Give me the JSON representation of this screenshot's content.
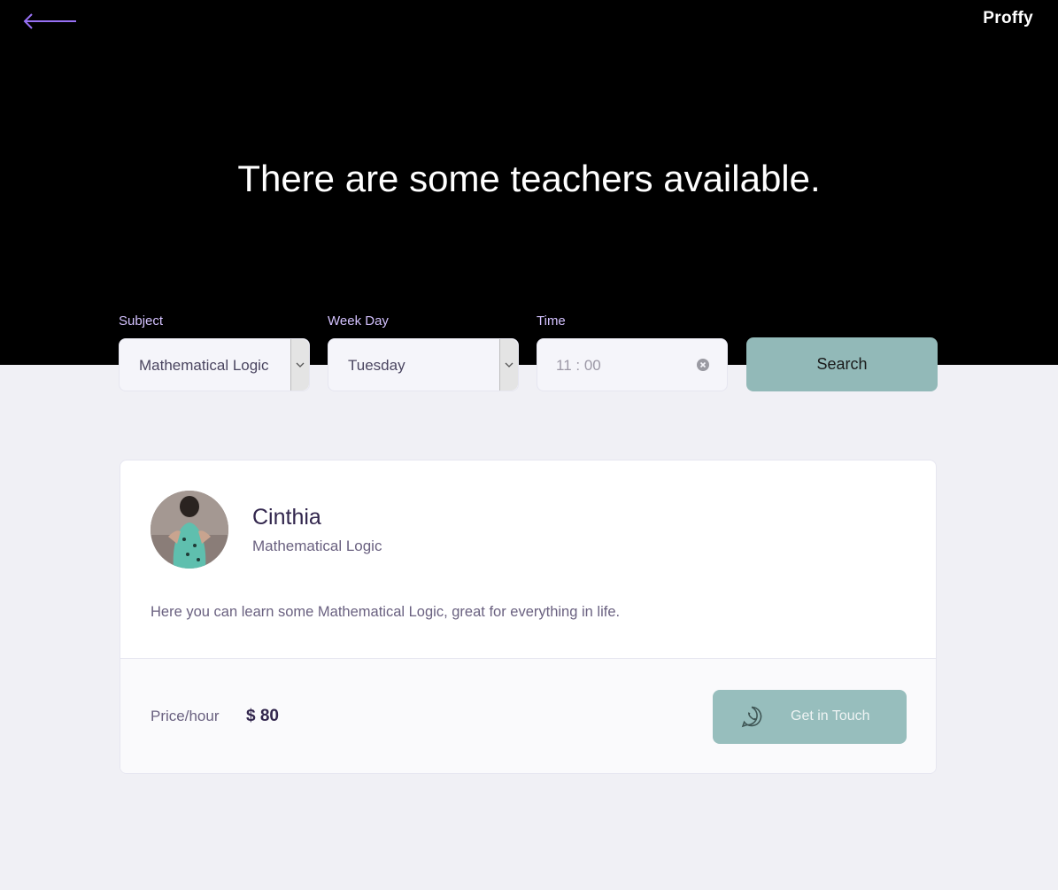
{
  "header": {
    "back_icon": "arrow-left-icon",
    "brand": "Proffy",
    "title": "There are some teachers available."
  },
  "filters": {
    "subject": {
      "label": "Subject",
      "value": "Mathematical Logic"
    },
    "week_day": {
      "label": "Week Day",
      "value": "Tuesday"
    },
    "time": {
      "label": "Time",
      "value": "11 : 00"
    },
    "search_label": "Search"
  },
  "teacher": {
    "name": "Cinthia",
    "subject": "Mathematical Logic",
    "bio": "Here you can learn some Mathematical Logic, great for everything in life.",
    "price_label": "Price/hour",
    "price_value": "$ 80",
    "contact_label": "Get in Touch",
    "contact_icon": "whatsapp-icon"
  },
  "colors": {
    "hero_bg": "#000000",
    "page_bg": "#f0f0f5",
    "accent": "#92b9b8",
    "back_arrow": "#9871f5",
    "heading": "#32264d",
    "text": "#6a6180"
  }
}
